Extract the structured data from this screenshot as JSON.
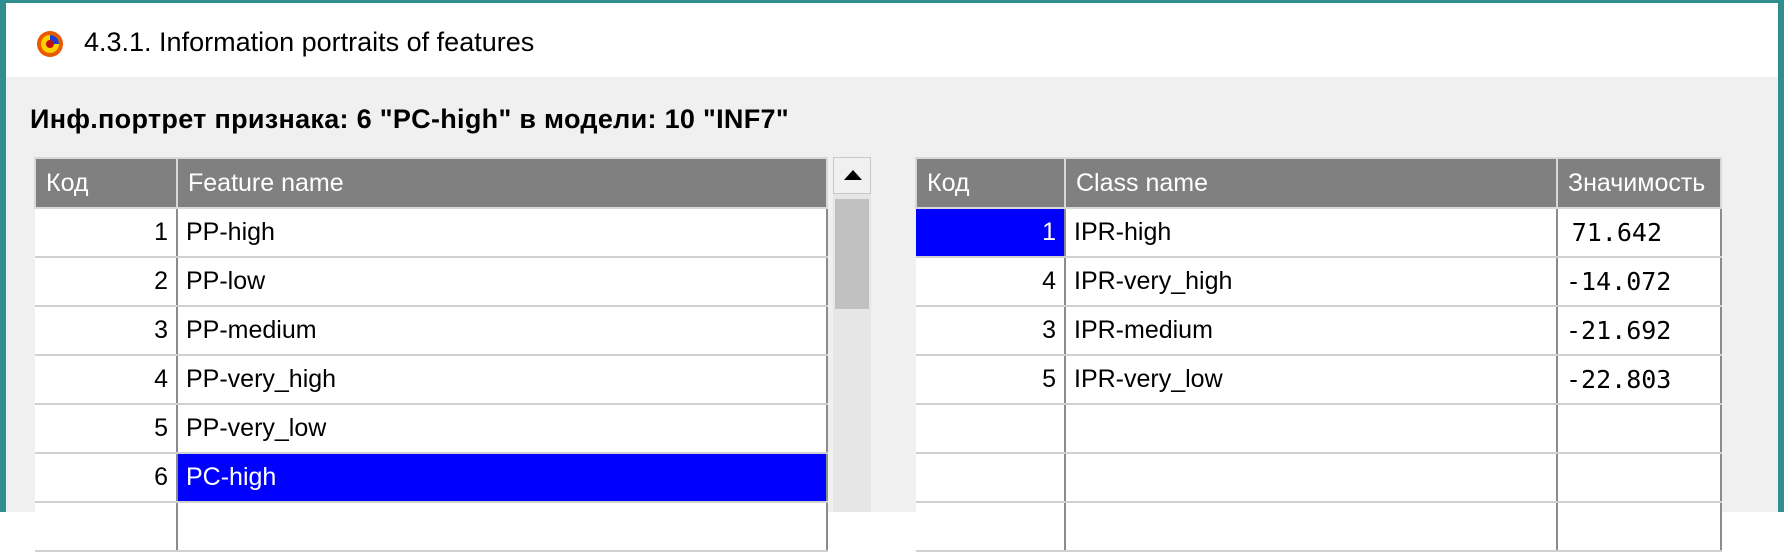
{
  "window": {
    "title": "4.3.1. Information portraits of features",
    "icon": "app-logo-icon"
  },
  "heading": "Инф.портрет признака: 6 \"PC-high\" в модели: 10 \"INF7\"",
  "features_table": {
    "columns": [
      "Код",
      "Feature name"
    ],
    "rows": [
      {
        "code": "1",
        "name": "PP-high"
      },
      {
        "code": "2",
        "name": "PP-low"
      },
      {
        "code": "3",
        "name": "PP-medium"
      },
      {
        "code": "4",
        "name": "PP-very_high"
      },
      {
        "code": "5",
        "name": "PP-very_low"
      },
      {
        "code": "6",
        "name": "PC-high"
      },
      {
        "code": "",
        "name": ""
      }
    ],
    "selected_row": 6
  },
  "classes_table": {
    "columns": [
      "Код",
      "Class name",
      "Значимость"
    ],
    "rows": [
      {
        "code": "1",
        "name": "IPR-high",
        "value": "71.642"
      },
      {
        "code": "4",
        "name": "IPR-very_high",
        "value": "-14.072"
      },
      {
        "code": "3",
        "name": "IPR-medium",
        "value": "-21.692"
      },
      {
        "code": "5",
        "name": "IPR-very_low",
        "value": "-22.803"
      },
      {
        "code": "",
        "name": "",
        "value": ""
      },
      {
        "code": "",
        "name": "",
        "value": ""
      },
      {
        "code": "",
        "name": "",
        "value": ""
      }
    ],
    "selected_row": 1
  },
  "colors": {
    "frame": "#2f8f8f",
    "header_bg": "#808080",
    "selection": "#0000ff",
    "positive": "#d00000",
    "negative": "#0000c8"
  }
}
